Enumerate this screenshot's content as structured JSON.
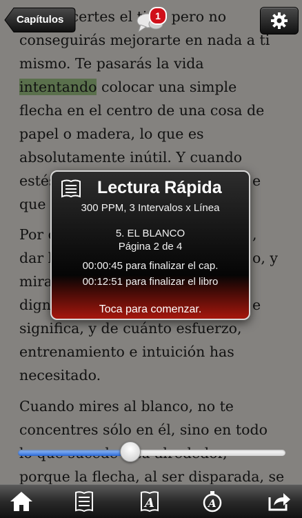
{
  "header": {
    "back_label": "Capítulos",
    "notification_count": "1"
  },
  "text": {
    "l1": "quizá acertes el tiro, pero no",
    "l2": "conseguirás mejorarte en nada a ti",
    "l3": "mismo. Te pasarás la vida",
    "l4_hl": "intentando",
    "l4_rest": " colocar una simple",
    "l5": "flecha en el centro de una cosa de",
    "l6": "papel o madera, lo que es",
    "l7": "absolutamente inútil. Y cuando",
    "l8_start": "estés",
    "l8_end": "e",
    "l9": "que",
    "l10_start": "Por c",
    "l10_end": ",",
    "l11_start": "dar l",
    "l11_end": "o, y",
    "l12": "mira",
    "l13_start": "dign",
    "l13_end": "e",
    "l14": "significa, y de cuánto esfuerzo,",
    "l15": "entrenamiento e intuición has",
    "l16": "necesitado.",
    "l17": "Cuando mires al blanco, no te",
    "l18": "concentres sólo en él, sino en todo",
    "l19": "lo que sucede a tu alrededor,",
    "l20": "porque la flecha, al ser disparada, se"
  },
  "popup": {
    "title": "Lectura Rápida",
    "speed": "300 PPM, 3 Intervalos x Línea",
    "chapter": "5. EL BLANCO",
    "page": "Página 2 de 4",
    "time_chapter": "00:00:45 para finalizar el cap.",
    "time_book": "00:12:51 para finalizar el libro",
    "cta": "Toca para comenzar."
  },
  "slider": {
    "progress": 0.42
  },
  "toolbar": {
    "icons": [
      "home-icon",
      "book-list-icon",
      "font-icon",
      "speed-read-icon",
      "share-icon"
    ]
  }
}
